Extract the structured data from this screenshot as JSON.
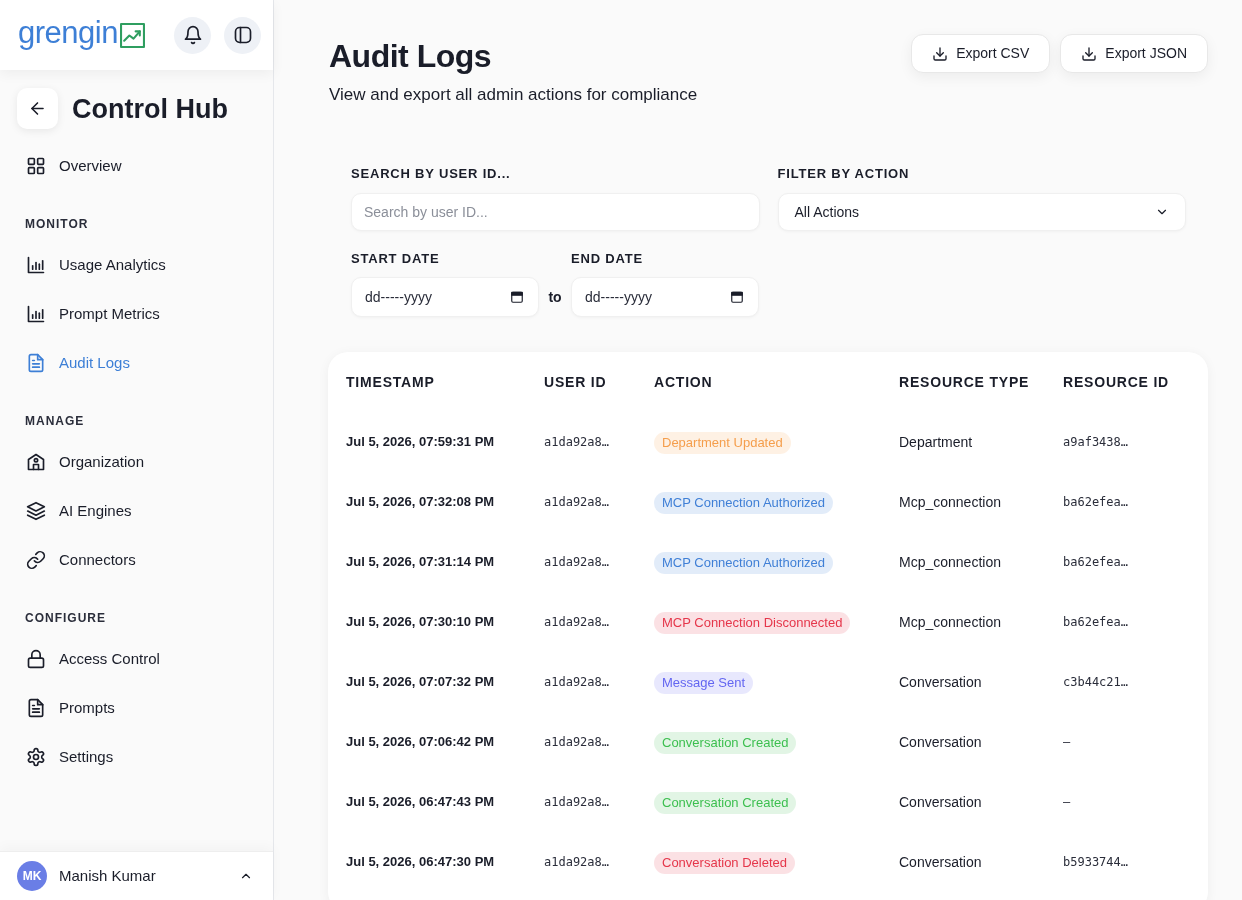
{
  "sidebar": {
    "brand": "grengin",
    "title": "Control Hub",
    "sections": [
      {
        "items": [
          {
            "label": "Overview",
            "selected": false
          }
        ]
      },
      {
        "label": "MONITOR",
        "items": [
          {
            "label": "Usage Analytics",
            "selected": false
          },
          {
            "label": "Prompt Metrics",
            "selected": false
          },
          {
            "label": "Audit Logs",
            "selected": true
          }
        ]
      },
      {
        "label": "MANAGE",
        "items": [
          {
            "label": "Organization",
            "selected": false
          },
          {
            "label": "AI Engines",
            "selected": false
          },
          {
            "label": "Connectors",
            "selected": false
          }
        ]
      },
      {
        "label": "CONFIGURE",
        "items": [
          {
            "label": "Access Control",
            "selected": false
          },
          {
            "label": "Prompts",
            "selected": false
          },
          {
            "label": "Settings",
            "selected": false
          }
        ]
      }
    ],
    "user": {
      "initials": "MK",
      "name": "Manish Kumar"
    }
  },
  "page": {
    "title": "Audit Logs",
    "subtitle": "View and export all admin actions for compliance",
    "actions": [
      "Export CSV",
      "Export JSON"
    ]
  },
  "filters": {
    "search": {
      "label": "SEARCH BY USER ID...",
      "placeholder": "Search by user ID..."
    },
    "action": {
      "label": "FILTER BY ACTION",
      "value": "All Actions"
    },
    "start_date": {
      "label": "START DATE",
      "placeholder": "dd-----yyyy"
    },
    "separator": "to",
    "end_date": {
      "label": "END DATE",
      "placeholder": "dd-----yyyy"
    }
  },
  "table": {
    "columns": [
      "TIMESTAMP",
      "USER ID",
      "ACTION",
      "RESOURCE TYPE",
      "RESOURCE ID"
    ],
    "rows": [
      {
        "timestamp": "Jul 5, 2026, 07:59:31 PM",
        "user_id": "a1da92a8…",
        "action": {
          "label": "Department Updated",
          "color": "#f59e4c"
        },
        "resource_type": "Department",
        "resource_id": "a9af3438…"
      },
      {
        "timestamp": "Jul 5, 2026, 07:32:08 PM",
        "user_id": "a1da92a8…",
        "action": {
          "label": "MCP Connection Authorized",
          "color": "#3f7fd6"
        },
        "resource_type": "Mcp_connection",
        "resource_id": "ba62efea…"
      },
      {
        "timestamp": "Jul 5, 2026, 07:31:14 PM",
        "user_id": "a1da92a8…",
        "action": {
          "label": "MCP Connection Authorized",
          "color": "#3f7fd6"
        },
        "resource_type": "Mcp_connection",
        "resource_id": "ba62efea…"
      },
      {
        "timestamp": "Jul 5, 2026, 07:30:10 PM",
        "user_id": "a1da92a8…",
        "action": {
          "label": "MCP Connection Disconnected",
          "color": "#e5364a"
        },
        "resource_type": "Mcp_connection",
        "resource_id": "ba62efea…"
      },
      {
        "timestamp": "Jul 5, 2026, 07:07:32 PM",
        "user_id": "a1da92a8…",
        "action": {
          "label": "Message Sent",
          "color": "#6366f1"
        },
        "resource_type": "Conversation",
        "resource_id": "c3b44c21…"
      },
      {
        "timestamp": "Jul 5, 2026, 07:06:42 PM",
        "user_id": "a1da92a8…",
        "action": {
          "label": "Conversation Created",
          "color": "#3cbf4f"
        },
        "resource_type": "Conversation",
        "resource_id": "–"
      },
      {
        "timestamp": "Jul 5, 2026, 06:47:43 PM",
        "user_id": "a1da92a8…",
        "action": {
          "label": "Conversation Created",
          "color": "#3cbf4f"
        },
        "resource_type": "Conversation",
        "resource_id": "–"
      },
      {
        "timestamp": "Jul 5, 2026, 06:47:30 PM",
        "user_id": "a1da92a8…",
        "action": {
          "label": "Conversation Deleted",
          "color": "#e5364a"
        },
        "resource_type": "Conversation",
        "resource_id": "b5933744…"
      }
    ]
  }
}
